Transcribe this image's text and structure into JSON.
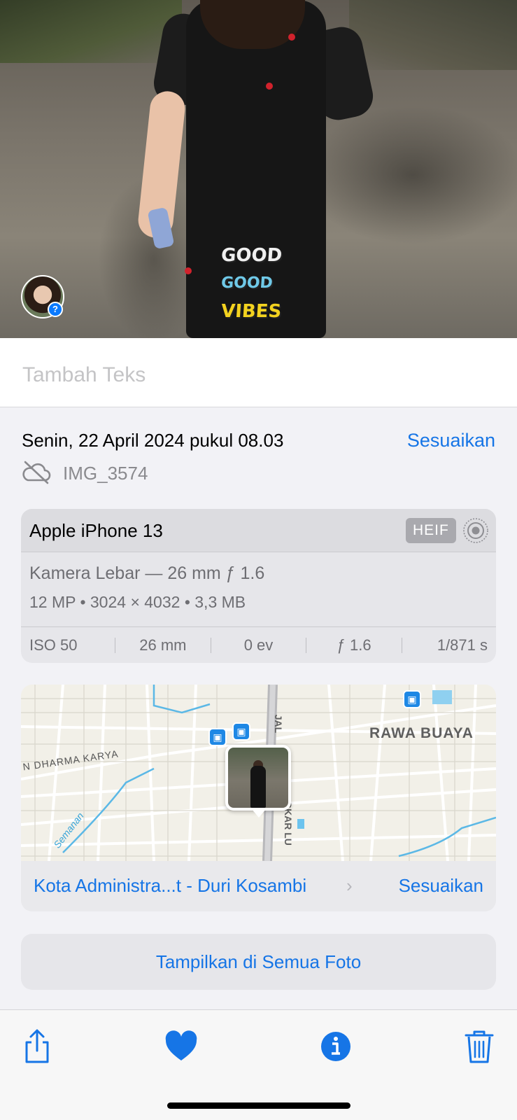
{
  "caption": {
    "placeholder": "Tambah Teks"
  },
  "photo": {
    "shirt_print": [
      "GOOD",
      "GOOD",
      "VIBES"
    ]
  },
  "info": {
    "date": "Senin, 22 April 2024 pukul 08.03",
    "adjust_label": "Sesuaikan",
    "filename": "IMG_3574"
  },
  "camera": {
    "device": "Apple iPhone 13",
    "format_badge": "HEIF",
    "lens": "Kamera Lebar — 26 mm ƒ 1.6",
    "specs": "12 MP  •  3024 × 4032  •  3,3 MB",
    "exif": [
      "ISO 50",
      "26 mm",
      "0 ev",
      "ƒ 1.6",
      "1/871 s"
    ]
  },
  "map": {
    "labels": {
      "area": "RAWA BUAYA",
      "street": "N DHARMA KARYA",
      "river": "Semanan",
      "road_top": "JAL",
      "road_bottom": "GKAR LU"
    },
    "place": "Kota Administra...t - Duri Kosambi",
    "adjust_label": "Sesuaikan"
  },
  "show_all": "Tampilkan di Semua Foto",
  "toolbar": {
    "icons": [
      "share-icon",
      "heart-icon",
      "info-icon",
      "trash-icon"
    ],
    "accent": "#1675e6"
  },
  "colors": {
    "accent": "#1675e6",
    "secondary_text": "#8a8a8e",
    "badge": "#a9a9ae"
  }
}
